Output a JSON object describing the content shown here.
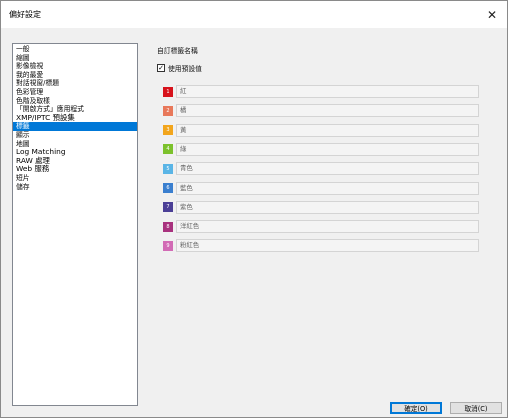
{
  "window": {
    "title": "偏好設定",
    "close_glyph": "✕"
  },
  "sidebar": {
    "items": [
      {
        "label": "一般"
      },
      {
        "label": "縮圖"
      },
      {
        "label": "影像檢視"
      },
      {
        "label": "我的最愛"
      },
      {
        "label": "對話視窗/標題"
      },
      {
        "label": "色彩管理"
      },
      {
        "label": "色階及取樣"
      },
      {
        "label": "「開啟方式」應用程式"
      },
      {
        "label": "XMP/IPTC 預設集"
      },
      {
        "label": "標籤",
        "selected": true
      },
      {
        "label": "顯示"
      },
      {
        "label": "地圖"
      },
      {
        "label": "Log Matching"
      },
      {
        "label": "RAW 處理"
      },
      {
        "label": "Web 服務"
      },
      {
        "label": "短片"
      },
      {
        "label": "儲存"
      }
    ]
  },
  "panel": {
    "section_title": "自訂標籤名稱",
    "use_default_checkbox": {
      "label": "使用預設值",
      "checked": true,
      "glyph": "✓"
    },
    "labels": [
      {
        "number": "1",
        "name": "紅",
        "color": "#d7121b"
      },
      {
        "number": "2",
        "name": "橘",
        "color": "#e8785a"
      },
      {
        "number": "3",
        "name": "黃",
        "color": "#f2a51c"
      },
      {
        "number": "4",
        "name": "綠",
        "color": "#7cc12c"
      },
      {
        "number": "5",
        "name": "青色",
        "color": "#5ab5e6"
      },
      {
        "number": "6",
        "name": "藍色",
        "color": "#3a7fcf"
      },
      {
        "number": "7",
        "name": "紫色",
        "color": "#4b3f96"
      },
      {
        "number": "8",
        "name": "洋紅色",
        "color": "#a8327e"
      },
      {
        "number": "9",
        "name": "粉紅色",
        "color": "#d26bb5"
      }
    ]
  },
  "buttons": {
    "ok": "確定(O)",
    "cancel": "取消(C)"
  }
}
